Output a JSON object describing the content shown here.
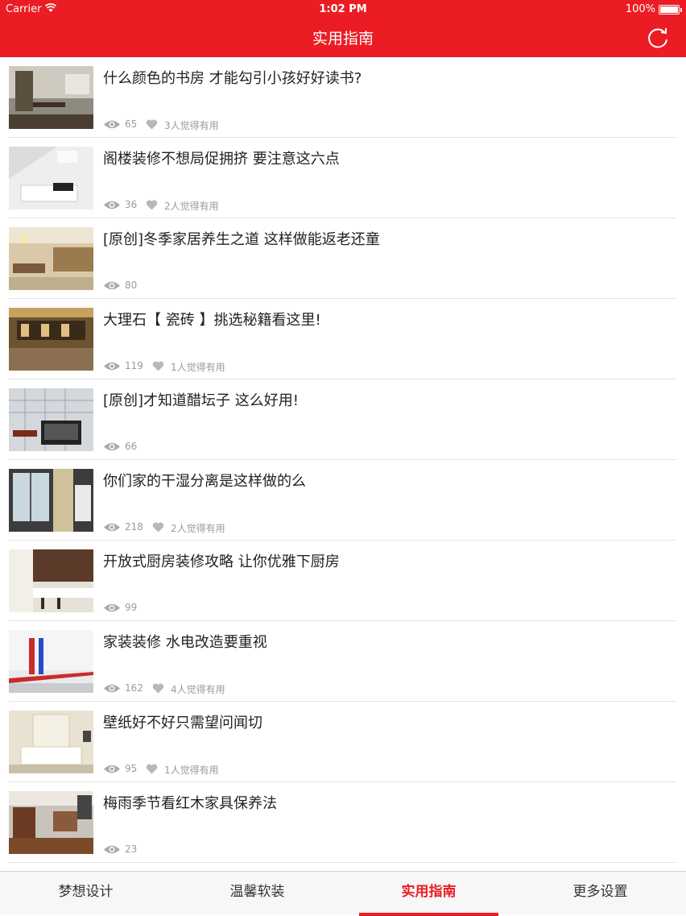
{
  "statusbar": {
    "carrier": "Carrier",
    "time": "1:02 PM",
    "battery": "100%"
  },
  "nav": {
    "title": "实用指南",
    "refresh_icon": "refresh-icon"
  },
  "colors": {
    "brand": "#ec1c24"
  },
  "articles": [
    {
      "title": "什么颜色的书房  才能勾引小孩好好读书?",
      "views": "65",
      "useful": "3人觉得有用"
    },
    {
      "title": "阁楼装修不想局促拥挤  要注意这六点",
      "views": "36",
      "useful": "2人觉得有用"
    },
    {
      "title": "[原创]冬季家居养生之道 这样做能返老还童",
      "views": "80",
      "useful": ""
    },
    {
      "title": "大理石【 瓷砖 】挑选秘籍看这里!",
      "views": "119",
      "useful": "1人觉得有用"
    },
    {
      "title": "[原创]才知道醋坛子  这么好用!",
      "views": "66",
      "useful": ""
    },
    {
      "title": "你们家的干湿分离是这样做的么",
      "views": "218",
      "useful": "2人觉得有用"
    },
    {
      "title": "开放式厨房装修攻略  让你优雅下厨房",
      "views": "99",
      "useful": ""
    },
    {
      "title": "家装装修  水电改造要重视",
      "views": "162",
      "useful": "4人觉得有用"
    },
    {
      "title": "壁纸好不好只需望问闻切",
      "views": "95",
      "useful": "1人觉得有用"
    },
    {
      "title": "梅雨季节看红木家具保养法",
      "views": "23",
      "useful": ""
    }
  ],
  "tabs": [
    {
      "label": "梦想设计",
      "active": false
    },
    {
      "label": "温馨软装",
      "active": false
    },
    {
      "label": "实用指南",
      "active": true
    },
    {
      "label": "更多设置",
      "active": false
    }
  ]
}
